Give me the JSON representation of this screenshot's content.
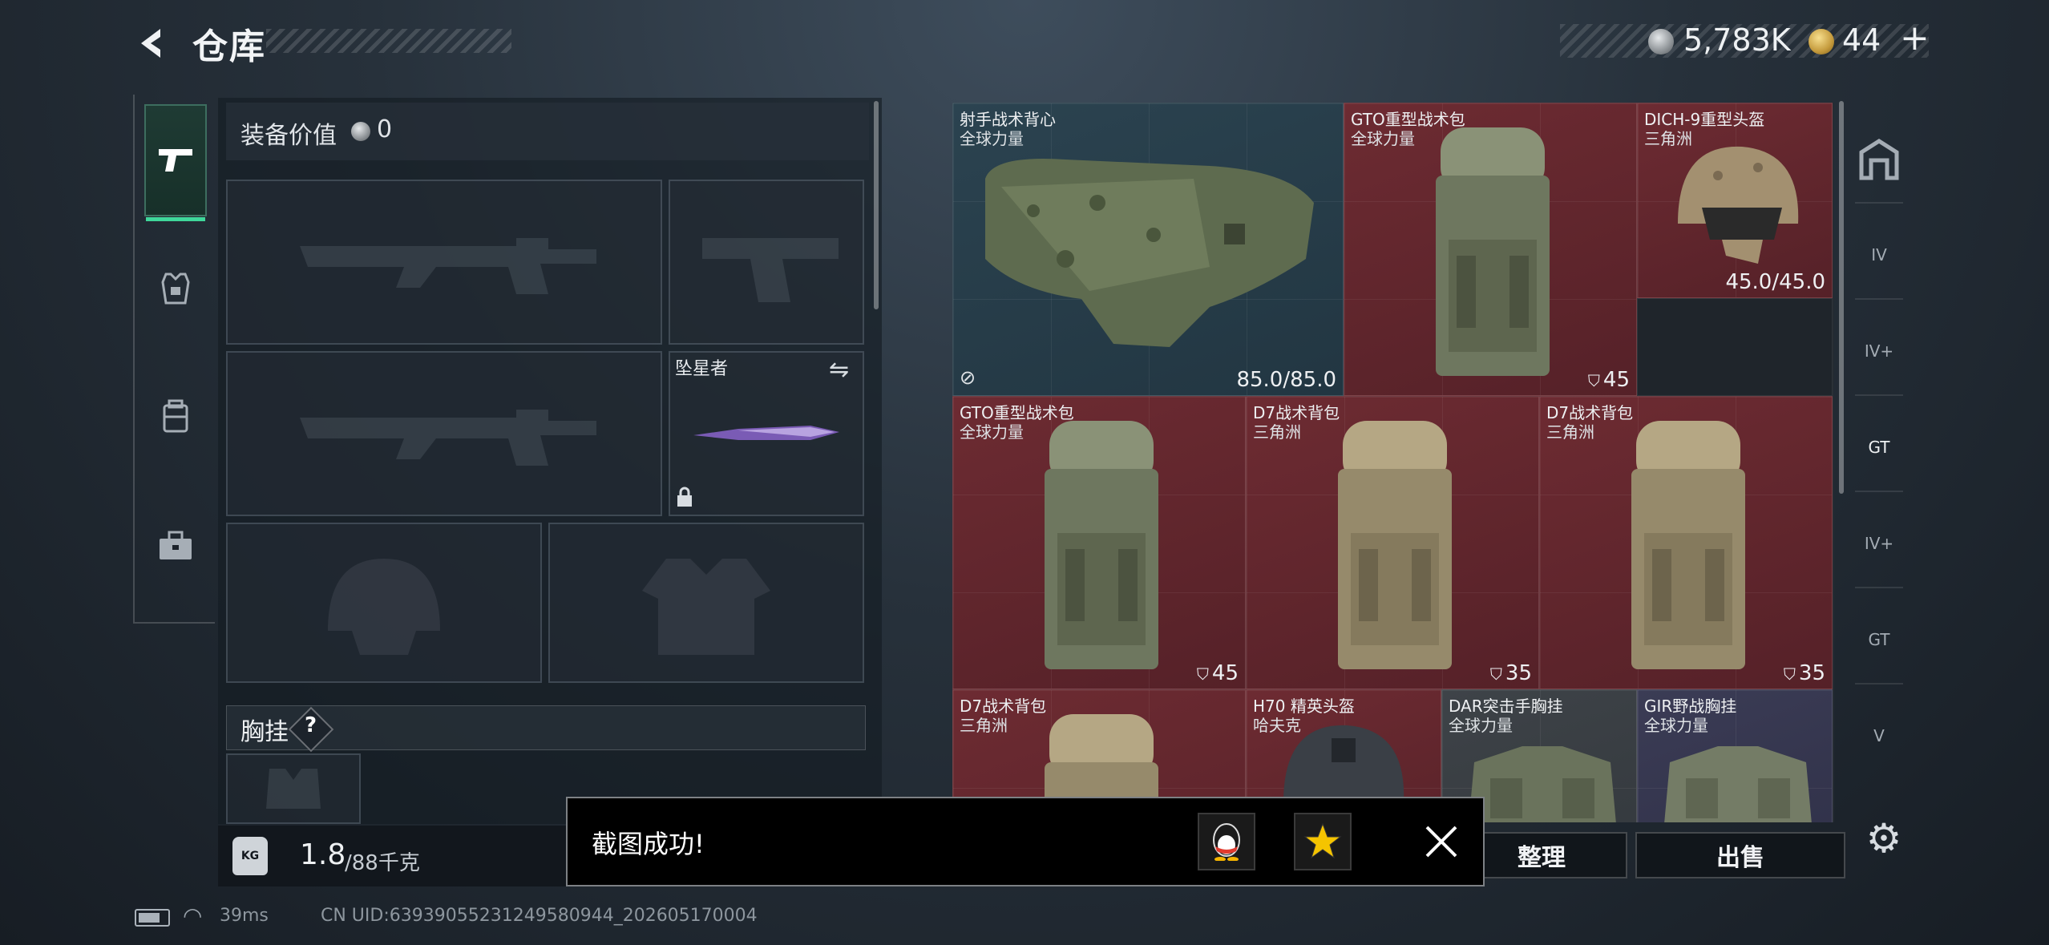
{
  "header": {
    "title": "仓库",
    "silver_value": "5,783K",
    "gold_value": "44",
    "gold_plus": "+"
  },
  "left_tabs": [
    {
      "icon": "pistol-icon",
      "active": true
    },
    {
      "icon": "armor-rig-icon",
      "active": false
    },
    {
      "icon": "backpack-icon",
      "active": false
    },
    {
      "icon": "toolbox-icon",
      "active": false
    }
  ],
  "loadout": {
    "equip_value_label": "装备价值",
    "equip_value_amount": "0",
    "melee_name": "坠星者",
    "chest_rig_label": "胸挂",
    "chest_rig_help": "?"
  },
  "capacity": {
    "current": "1.8",
    "max": "/88千克",
    "icon_text": "KG"
  },
  "status": {
    "ping": "39ms",
    "uid": "CN UID:6393905523124958094‌4_202605170004"
  },
  "inventory": [
    {
      "name": "射手战术背心",
      "origin": "全球力量",
      "durability": "85.0/85.0",
      "rarity": "blue",
      "type": "vest"
    },
    {
      "name": "GTO重型战术包",
      "origin": "全球力量",
      "capacity": "45",
      "rarity": "red",
      "type": "backpack"
    },
    {
      "name": "DICH-9重型头盔",
      "origin": "三角洲",
      "durability": "45.0/45.0",
      "rarity": "red",
      "type": "helmet"
    },
    {
      "name": "GTO重型战术包",
      "origin": "全球力量",
      "capacity": "45",
      "rarity": "red",
      "type": "backpack"
    },
    {
      "name": "D7战术背包",
      "origin": "三角洲",
      "capacity": "35",
      "rarity": "red",
      "type": "backpack"
    },
    {
      "name": "D7战术背包",
      "origin": "三角洲",
      "capacity": "35",
      "rarity": "red",
      "type": "backpack"
    },
    {
      "name": "D7战术背包",
      "origin": "三角洲",
      "rarity": "red",
      "type": "backpack"
    },
    {
      "name": "H70 精英头盔",
      "origin": "哈夫克",
      "rarity": "red",
      "type": "helmet"
    },
    {
      "name": "DAR突击手胸挂",
      "origin": "全球力量",
      "rarity": "gray",
      "type": "rig"
    },
    {
      "name": "GIR野战胸挂",
      "origin": "全球力量",
      "rarity": "purple",
      "type": "rig"
    }
  ],
  "right_rail": [
    {
      "icon": "armor-filter-icon",
      "label": ""
    },
    {
      "icon": "container-iv-icon",
      "label": "IV"
    },
    {
      "icon": "container-iv-plus-icon",
      "label": "IV+"
    },
    {
      "icon": "container-gt-icon",
      "label": "GT"
    },
    {
      "icon": "container-iv-plus-2-icon",
      "label": "IV+"
    },
    {
      "icon": "container-gt-2-icon",
      "label": "GT"
    },
    {
      "icon": "container-v-icon",
      "label": "V"
    }
  ],
  "actions": {
    "sort_label": "整理",
    "sell_label": "出售"
  },
  "toast": {
    "message": "截图成功!"
  },
  "colors": {
    "accent_green": "#3fd79a",
    "rarity_red": "#6d2b32",
    "rarity_blue": "#2b4350",
    "rarity_gray": "#3e4348",
    "rarity_purple": "#3b3c55"
  }
}
